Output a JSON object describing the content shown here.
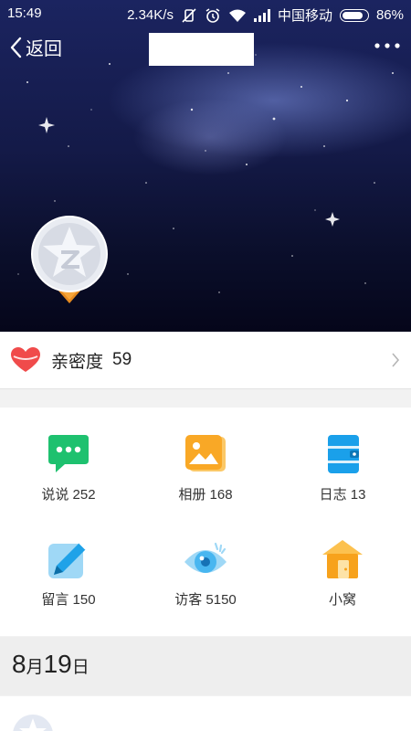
{
  "status_bar": {
    "time": "15:49",
    "network_speed": "2.34K/s",
    "carrier": "中国移动",
    "battery": "86%"
  },
  "nav": {
    "back_label": "返回"
  },
  "intimacy": {
    "label": "亲密度",
    "value": "59"
  },
  "features": [
    {
      "label": "说说 252",
      "icon": "chat-bubble-icon"
    },
    {
      "label": "相册 168",
      "icon": "photo-album-icon"
    },
    {
      "label": "日志 13",
      "icon": "blog-notebook-icon"
    },
    {
      "label": "留言 150",
      "icon": "message-board-pen-icon"
    },
    {
      "label": "访客 5150",
      "icon": "visitor-eye-icon"
    },
    {
      "label": "小窝",
      "icon": "home-house-icon"
    }
  ],
  "feed": {
    "date_month": "8",
    "date_month_unit": "月",
    "date_day": "19",
    "date_day_unit": "日"
  },
  "colors": {
    "chat": "#1ec16f",
    "album": "#f9a826",
    "blog": "#1aa0ea",
    "visitor": "#48b6f0",
    "home": "#f7a21c",
    "heart": "#f04b4b"
  }
}
